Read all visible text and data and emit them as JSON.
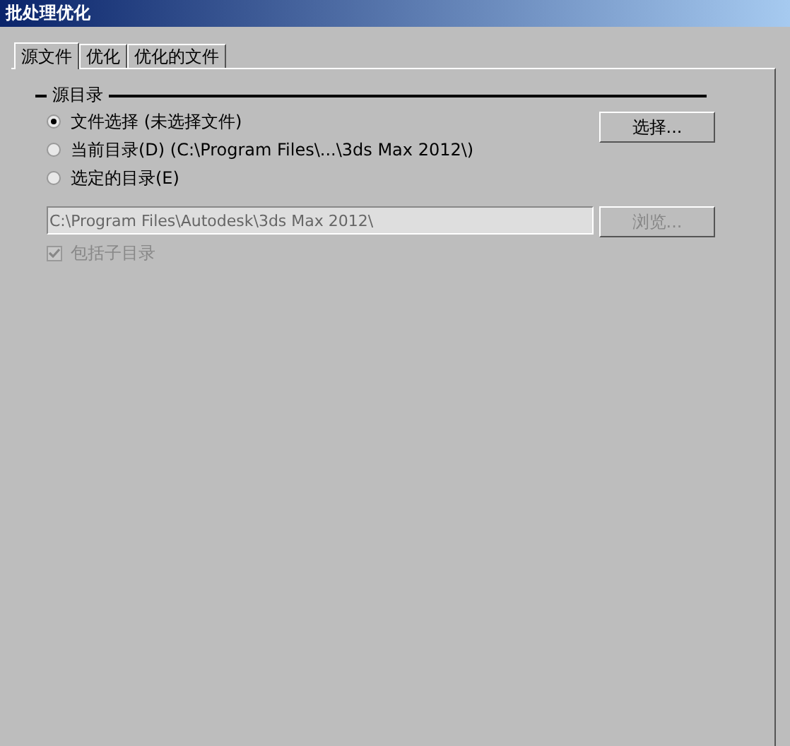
{
  "window": {
    "title": "批处理优化"
  },
  "tabs": [
    {
      "label": "源文件",
      "selected": true
    },
    {
      "label": "优化",
      "selected": false
    },
    {
      "label": "优化的文件",
      "selected": false
    }
  ],
  "source_group": {
    "title": "源目录",
    "options": [
      {
        "label": "文件选择 (未选择文件)",
        "selected": true
      },
      {
        "label": "当前目录(D) (C:\\Program Files\\...\\3ds Max 2012\\)",
        "selected": false
      },
      {
        "label": "选定的目录(E)",
        "selected": false
      }
    ],
    "select_button": {
      "label": "选择...",
      "disabled": false
    },
    "path_field": {
      "value": "C:\\Program Files\\Autodesk\\3ds Max 2012\\",
      "disabled": true
    },
    "browse_button": {
      "label": "浏览...",
      "disabled": true
    },
    "include_subdirs": {
      "label": "包括子目录",
      "checked": true,
      "disabled": true
    }
  }
}
